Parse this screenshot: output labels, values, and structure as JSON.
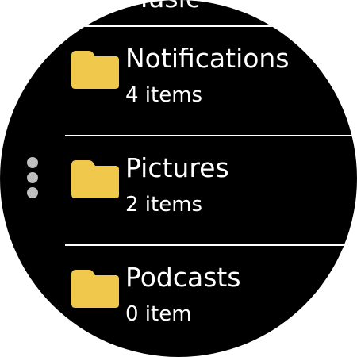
{
  "previous_item": {
    "name_partial": "Music"
  },
  "folders": [
    {
      "name": "Notifications",
      "count_text": "4 items",
      "icon": "folder-icon"
    },
    {
      "name": "Pictures",
      "count_text": "2 items",
      "icon": "folder-icon"
    },
    {
      "name": "Podcasts",
      "count_text": "0 item",
      "icon": "folder-icon"
    }
  ],
  "more_options": {
    "icon": "more-vertical-icon"
  },
  "colors": {
    "background": "#000000",
    "text": "#ffffff",
    "folder": "#f0c94c",
    "dots": "#bfbfbf"
  }
}
